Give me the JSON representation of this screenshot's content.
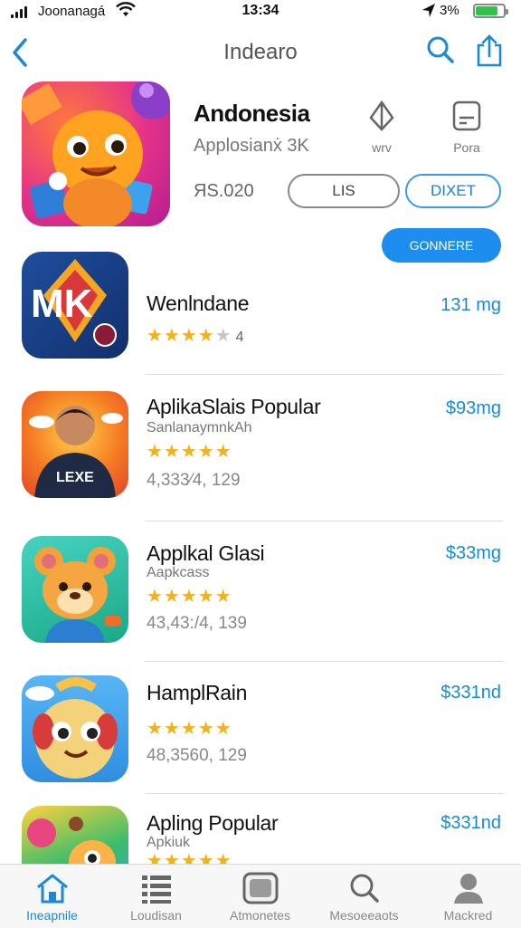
{
  "status_bar": {
    "carrier": "Joonanagá",
    "time": "13:34",
    "battery": "3%",
    "battery_level": 0.8
  },
  "nav": {
    "title": "Indearo"
  },
  "featured": {
    "name": "Andonesia",
    "subtitle": "Applosianẋ 3K",
    "price": "ЯS.020",
    "action1_label": "wrv",
    "action2_label": "Pora",
    "button1": "LIS",
    "button2": "DIXET",
    "button3": "GONNERE"
  },
  "apps": [
    {
      "name": "Wenlndane",
      "subtitle": "",
      "rating": 3.5,
      "rating_count": "4",
      "meta": "",
      "price": "131 mg"
    },
    {
      "name": "AplikaSlais Popular",
      "subtitle": "SanlanaymnkAh",
      "rating": 5,
      "rating_count": "",
      "meta": "4,333⁄4, 129",
      "price": "$93mg"
    },
    {
      "name": "Applkal Glasi",
      "subtitle": "Aapkcass",
      "rating": 4.5,
      "rating_count": "",
      "meta": "43,43:/4, 139",
      "price": "$33mg"
    },
    {
      "name": "HamplRain",
      "subtitle": "",
      "rating": 4.5,
      "rating_count": "",
      "meta": "48,3560, 129",
      "price": "$331nd"
    },
    {
      "name": "Apling Popular",
      "subtitle": "Apkiuk",
      "rating": 4.5,
      "rating_count": "",
      "meta": "",
      "price": "$331nd"
    }
  ],
  "tabs": [
    {
      "label": "Ineapnile",
      "icon": "home-icon",
      "active": true
    },
    {
      "label": "Loudisan",
      "icon": "list-icon",
      "active": false
    },
    {
      "label": "Atmonetes",
      "icon": "game-icon",
      "active": false
    },
    {
      "label": "Mesoeeaots",
      "icon": "search-icon",
      "active": false
    },
    {
      "label": "Mackred",
      "icon": "person-icon",
      "active": false
    }
  ],
  "colors": {
    "accent": "#1a8ad6",
    "star": "#f2b21b",
    "battery": "#30c24a"
  }
}
